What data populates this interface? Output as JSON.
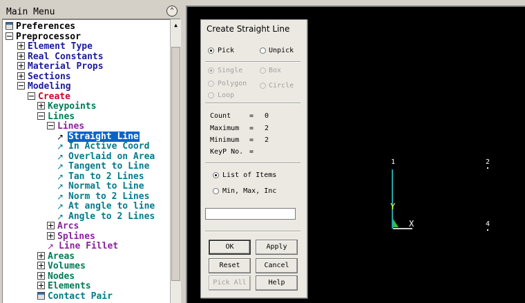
{
  "main_menu": {
    "title": "Main Menu",
    "collapse_icon": "double-chevron-up",
    "tree": [
      {
        "label": "Preferences",
        "icon": "preferences-icon"
      },
      {
        "label": "Preprocessor",
        "icon": "minus"
      },
      {
        "label": "Element Type",
        "icon": "plus"
      },
      {
        "label": "Real Constants",
        "icon": "plus"
      },
      {
        "label": "Material Props",
        "icon": "plus"
      },
      {
        "label": "Sections",
        "icon": "plus"
      },
      {
        "label": "Modeling",
        "icon": "minus"
      },
      {
        "label": "Create",
        "icon": "minus"
      },
      {
        "label": "Keypoints",
        "icon": "plus"
      },
      {
        "label": "Lines",
        "icon": "minus"
      },
      {
        "label": "Lines",
        "icon": "minus"
      },
      {
        "label": "Straight Line",
        "icon": "arrow",
        "selected": true
      },
      {
        "label": "In Active Coord",
        "icon": "arrow"
      },
      {
        "label": "Overlaid on Area",
        "icon": "arrow"
      },
      {
        "label": "Tangent to Line",
        "icon": "arrow"
      },
      {
        "label": "Tan to 2 Lines",
        "icon": "arrow"
      },
      {
        "label": "Normal to Line",
        "icon": "arrow"
      },
      {
        "label": "Norm to 2 Lines",
        "icon": "arrow"
      },
      {
        "label": "At angle to line",
        "icon": "arrow"
      },
      {
        "label": "Angle to 2 Lines",
        "icon": "arrow"
      },
      {
        "label": "Arcs",
        "icon": "plus"
      },
      {
        "label": "Splines",
        "icon": "plus"
      },
      {
        "label": "Line Fillet",
        "icon": "arrow"
      },
      {
        "label": "Areas",
        "icon": "plus"
      },
      {
        "label": "Volumes",
        "icon": "plus"
      },
      {
        "label": "Nodes",
        "icon": "plus"
      },
      {
        "label": "Elements",
        "icon": "plus"
      },
      {
        "label": "Contact Pair",
        "icon": "preferences-icon"
      }
    ]
  },
  "dialog": {
    "title": "Create Straight Line",
    "pick_label": "Pick",
    "unpick_label": "Unpick",
    "single_label": "Single",
    "box_label": "Box",
    "polygon_label": "Polygon",
    "circle_label": "Circle",
    "loop_label": "Loop",
    "count_label": "Count",
    "count_value": "0",
    "maximum_label": "Maximum",
    "maximum_value": "2",
    "minimum_label": "Minimum",
    "minimum_value": "2",
    "keyp_label": "KeyP No.",
    "eq": "=",
    "list_label": "List of Items",
    "minmax_label": "Min, Max, Inc",
    "input_value": "",
    "ok_label": "OK",
    "apply_label": "Apply",
    "reset_label": "Reset",
    "cancel_label": "Cancel",
    "pickall_label": "Pick All",
    "help_label": "Help"
  },
  "graphics": {
    "keypoints": [
      "1",
      "2",
      "4"
    ],
    "axis_y_label": "Y",
    "axis_x_label": "X",
    "background": "#000000",
    "y_axis_color": "#1fa6a6",
    "label_color": "#ffff33"
  }
}
